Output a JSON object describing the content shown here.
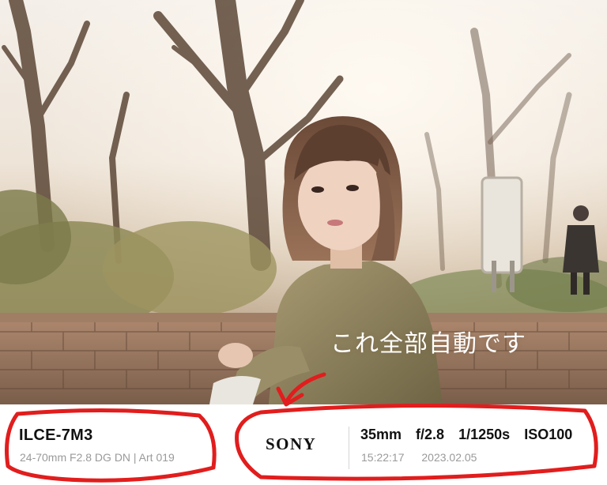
{
  "overlay": {
    "caption": "これ全部自動です"
  },
  "info_bar": {
    "camera_model": "ILCE-7M3",
    "lens_info": "24-70mm F2.8 DG DN | Art 019",
    "brand_logo_text": "SONY",
    "specs": {
      "focal_length": "35mm",
      "aperture": "f/2.8",
      "shutter_speed": "1/1250s",
      "iso": "ISO100"
    },
    "time": "15:22:17",
    "date": "2023.02.05"
  },
  "colors": {
    "annotation_red": "#e11d1d",
    "overlay_text": "#ffffff",
    "primary_text": "#111111",
    "secondary_text": "#9a9a9a"
  },
  "icons": {
    "arrow": "curved-arrow-icon"
  }
}
